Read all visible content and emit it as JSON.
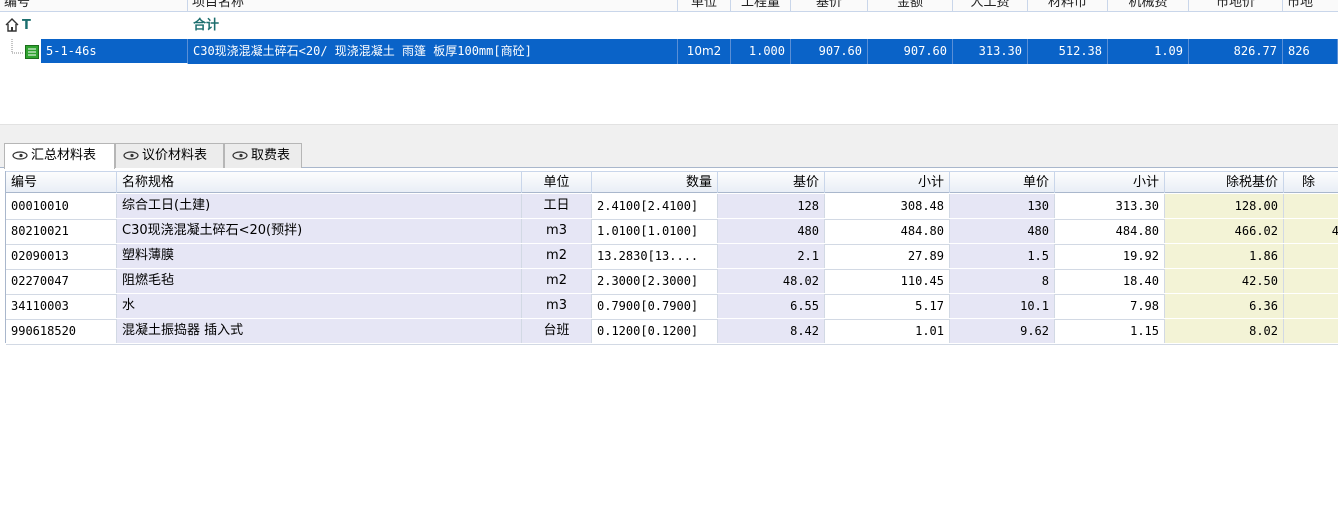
{
  "top_grid": {
    "headers": [
      "编号",
      "项目名称",
      "单位",
      "工程量",
      "基价",
      "金额",
      "人工费",
      "材料币",
      "机械费",
      "市地价",
      "市地"
    ],
    "total_row": {
      "code": "T",
      "name": "合计"
    },
    "item_row": {
      "code": "5-1-46s",
      "name": "C30现浇混凝土碎石<20/ 现浇混凝土 雨篷 板厚100mm[商砼]",
      "unit": "10m2",
      "qty": "1.000",
      "base_price": "907.60",
      "amount": "907.60",
      "labor": "313.30",
      "material": "512.38",
      "machine": "1.09",
      "market": "826.77",
      "market2": "826"
    }
  },
  "tabs": [
    {
      "label": "汇总材料表",
      "active": true
    },
    {
      "label": "议价材料表",
      "active": false
    },
    {
      "label": "取费表",
      "active": false
    }
  ],
  "material_grid": {
    "headers": {
      "code": "编号",
      "name": "名称规格",
      "unit": "单位",
      "qty": "数量",
      "base": "基价",
      "subtotal1": "小计",
      "price": "单价",
      "subtotal2": "小计",
      "tax_base": "除税基价",
      "tax2": "除"
    },
    "rows": [
      {
        "code": "00010010",
        "name": "综合工日(土建)",
        "unit": "工日",
        "qty": "2.4100[2.4100]",
        "base": "128",
        "subtotal1": "308.48",
        "price": "130",
        "subtotal2": "313.30",
        "tax_base": "128.00",
        "tax2": ""
      },
      {
        "code": "80210021",
        "name": "C30现浇混凝土碎石<20(预拌)",
        "unit": "m3",
        "qty": "1.0100[1.0100]",
        "base": "480",
        "subtotal1": "484.80",
        "price": "480",
        "subtotal2": "484.80",
        "tax_base": "466.02",
        "tax2": "4"
      },
      {
        "code": "02090013",
        "name": "塑料薄膜",
        "unit": "m2",
        "qty": "13.2830[13....",
        "base": "2.1",
        "subtotal1": "27.89",
        "price": "1.5",
        "subtotal2": "19.92",
        "tax_base": "1.86",
        "tax2": ""
      },
      {
        "code": "02270047",
        "name": "阻燃毛毡",
        "unit": "m2",
        "qty": "2.3000[2.3000]",
        "base": "48.02",
        "subtotal1": "110.45",
        "price": "8",
        "subtotal2": "18.40",
        "tax_base": "42.50",
        "tax2": ""
      },
      {
        "code": "34110003",
        "name": "水",
        "unit": "m3",
        "qty": "0.7900[0.7900]",
        "base": "6.55",
        "subtotal1": "5.17",
        "price": "10.1",
        "subtotal2": "7.98",
        "tax_base": "6.36",
        "tax2": ""
      },
      {
        "code": "990618520",
        "name": "混凝土振捣器 插入式",
        "unit": "台班",
        "qty": "0.1200[0.1200]",
        "base": "8.42",
        "subtotal1": "1.01",
        "price": "9.62",
        "subtotal2": "1.15",
        "tax_base": "8.02",
        "tax2": ""
      }
    ]
  },
  "colors": {
    "selection": "#0a63c8",
    "lavender": "#e6e6f5",
    "beige": "#f3f3d6",
    "total_text": "#1c6e6e"
  }
}
